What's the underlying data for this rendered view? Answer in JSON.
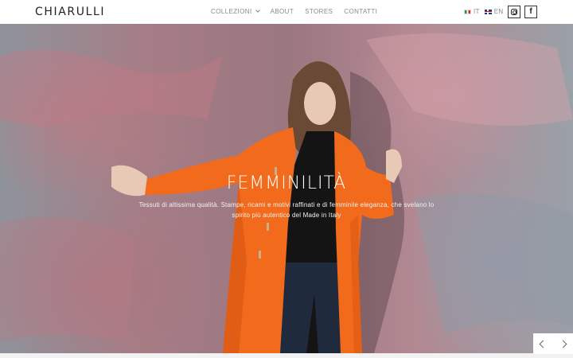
{
  "brand": {
    "logo": "CHIARULLI"
  },
  "nav": {
    "items": [
      {
        "label": "COLLEZIONI",
        "has_dropdown": true
      },
      {
        "label": "ABOUT"
      },
      {
        "label": "STORES"
      },
      {
        "label": "CONTATTI"
      }
    ]
  },
  "lang": {
    "it": "IT",
    "en": "EN",
    "flag_it": "italian-flag-icon",
    "flag_en": "uk-flag-icon"
  },
  "social": {
    "instagram": "instagram-icon",
    "facebook": "facebook-icon",
    "facebook_glyph": "f"
  },
  "hero": {
    "title": "FEMMINILITÀ",
    "subtitle": "Tessuti di altissima qualità. Stampe, ricami e motivi raffinati e di femminile eleganza, che svelano lo spirito più autentico del Made in Italy"
  },
  "slider": {
    "prev_icon": "chevron-left-icon",
    "next_icon": "chevron-right-icon"
  },
  "colors": {
    "coat": "#f26a1b",
    "header_bg": "#ffffff",
    "text_dark": "#222222",
    "nav_text": "#8a8a8a"
  }
}
